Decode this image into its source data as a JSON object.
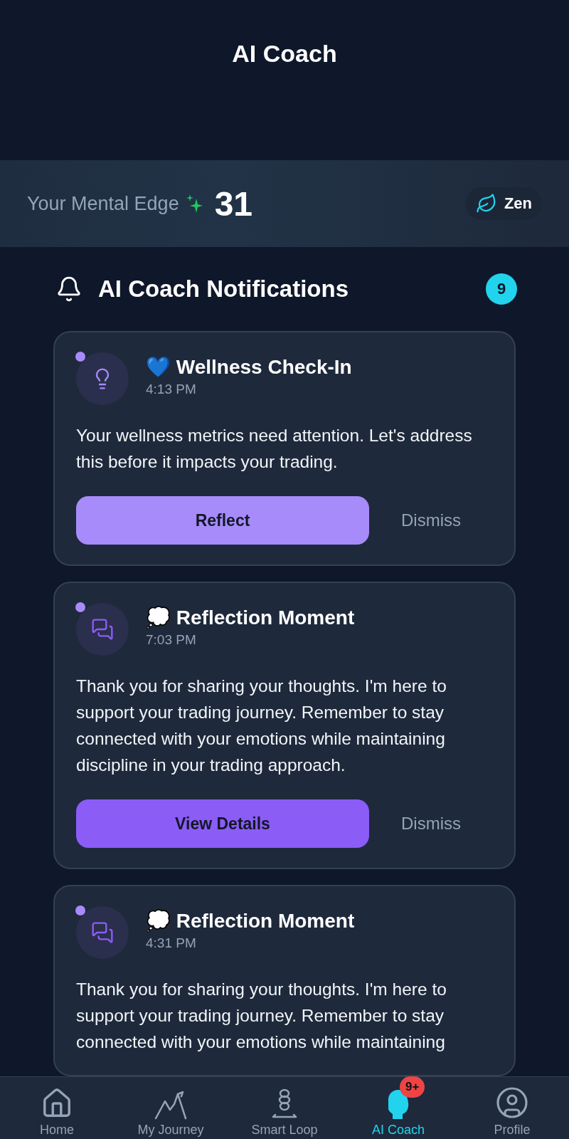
{
  "header": {
    "title": "AI Coach"
  },
  "mental_edge": {
    "label": "Your Mental Edge",
    "score": "31",
    "mode": "Zen"
  },
  "notifications": {
    "title": "AI Coach Notifications",
    "count": "9",
    "items": [
      {
        "kind": "lightbulb",
        "unread": true,
        "title": "💙 Wellness Check-In",
        "time": "4:13 PM",
        "body": "Your wellness metrics need attention. Let's address this before it impacts your trading.",
        "action": {
          "label": "Reflect",
          "kind": "light"
        },
        "dismiss": "Dismiss"
      },
      {
        "kind": "chat",
        "unread": true,
        "title": "💭 Reflection Moment",
        "time": "7:03 PM",
        "body": "Thank you for sharing your thoughts. I'm here to support your trading journey. Remember to stay connected with your emotions while maintaining discipline in your trading approach.",
        "action": {
          "label": "View Details",
          "kind": "solid"
        },
        "dismiss": "Dismiss"
      },
      {
        "kind": "chat",
        "unread": true,
        "title": "💭 Reflection Moment",
        "time": "4:31 PM",
        "body": "Thank you for sharing your thoughts. I'm here to support your trading journey. Remember to stay connected with your emotions while maintaining"
      }
    ]
  },
  "nav": [
    {
      "kind": "home",
      "label": "Home",
      "selected": false
    },
    {
      "kind": "mountain",
      "label": "My Journey",
      "selected": false
    },
    {
      "kind": "loop",
      "label": "Smart Loop",
      "selected": false
    },
    {
      "kind": "head",
      "label": "AI Coach",
      "selected": true,
      "badge": "9+"
    },
    {
      "kind": "profile",
      "label": "Profile",
      "selected": false
    }
  ]
}
